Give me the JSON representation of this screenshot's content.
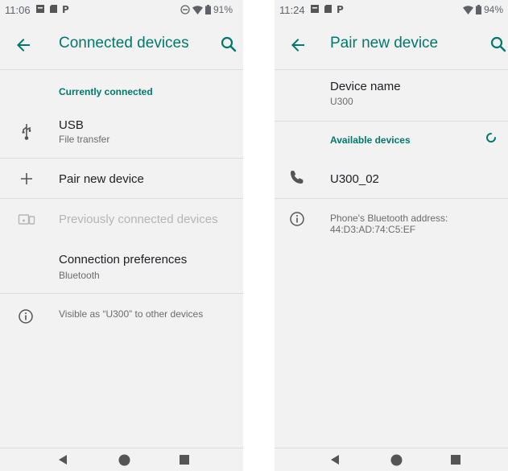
{
  "left": {
    "status": {
      "time": "11:06",
      "battery": "91%"
    },
    "title": "Connected devices",
    "currently_connected_header": "Currently connected",
    "usb": {
      "title": "USB",
      "subtitle": "File transfer"
    },
    "pair_new_device": "Pair new device",
    "previously_connected": "Previously connected devices",
    "connection_prefs": {
      "title": "Connection preferences",
      "subtitle": "Bluetooth"
    },
    "visible_as": "Visible as “U300” to other devices"
  },
  "right": {
    "status": {
      "time": "11:24",
      "battery": "94%"
    },
    "title": "Pair new device",
    "device_name": {
      "title": "Device name",
      "value": "U300"
    },
    "available_header": "Available devices",
    "devices": [
      {
        "name": "U300_02",
        "icon": "phone-icon"
      }
    ],
    "bt_address": {
      "label": "Phone's Bluetooth address:",
      "value": "44:D3:AD:74:C5:EF"
    }
  },
  "colors": {
    "accent": "#00796b",
    "background": "#f2f2f2",
    "divider": "#dadce0"
  }
}
